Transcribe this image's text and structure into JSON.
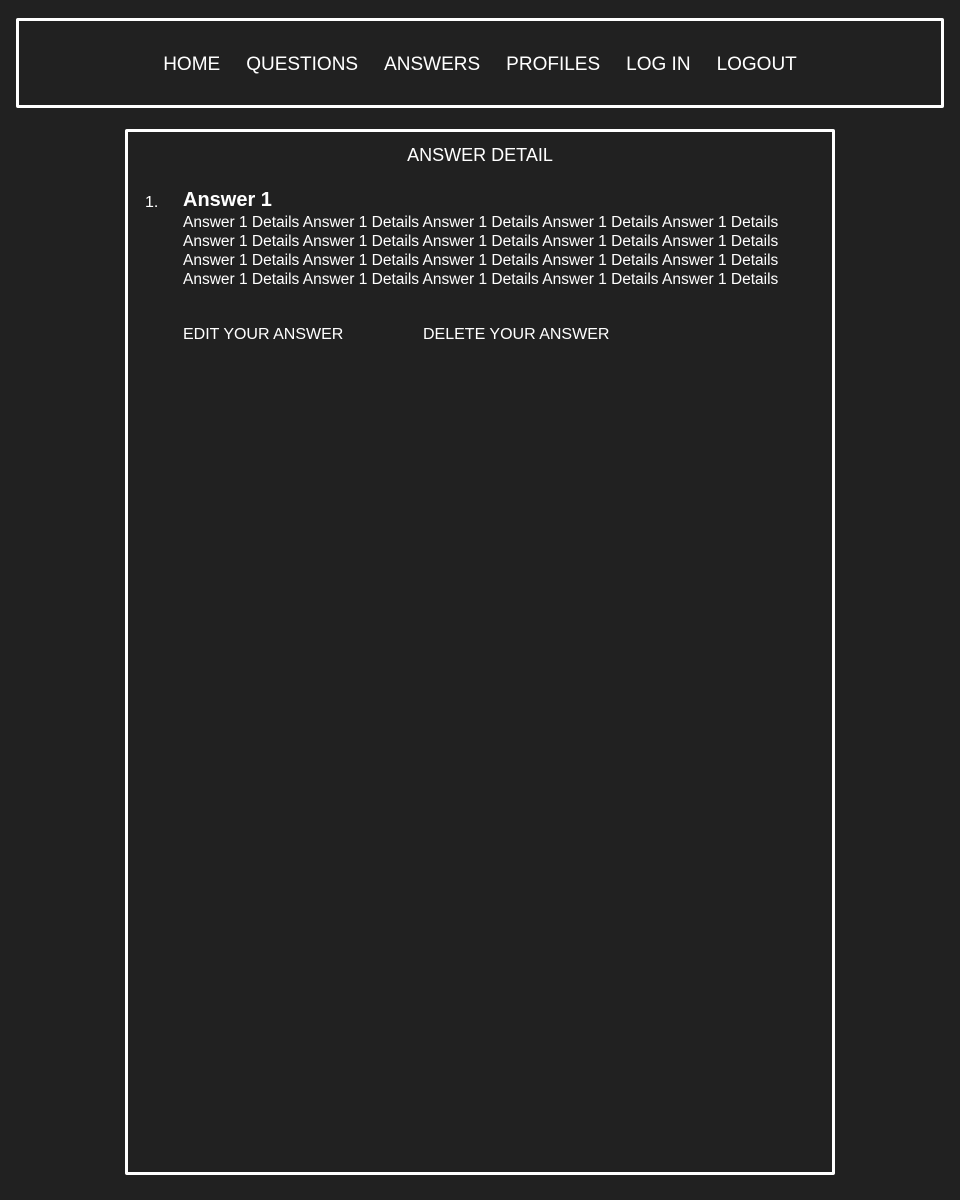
{
  "nav": {
    "items": [
      {
        "label": "HOME"
      },
      {
        "label": "QUESTIONS"
      },
      {
        "label": "ANSWERS"
      },
      {
        "label": "PROFILES"
      },
      {
        "label": "LOG IN"
      },
      {
        "label": "LOGOUT"
      }
    ]
  },
  "main": {
    "title": "ANSWER DETAIL",
    "answer": {
      "number": "1.",
      "heading": "Answer 1",
      "details": "Answer 1 Details Answer 1 Details Answer 1 Details Answer 1 Details Answer 1 Details Answer 1 Details Answer 1 Details Answer 1 Details Answer 1 Details Answer 1 Details Answer 1 Details Answer 1 Details Answer 1 Details Answer 1 Details Answer 1 Details Answer 1 Details Answer 1 Details Answer 1 Details Answer 1 Details Answer 1 Details"
    },
    "actions": {
      "edit_label": "EDIT YOUR ANSWER",
      "delete_label": "DELETE YOUR ANSWER"
    }
  },
  "colors": {
    "background": "#212121",
    "foreground": "#ffffff"
  }
}
